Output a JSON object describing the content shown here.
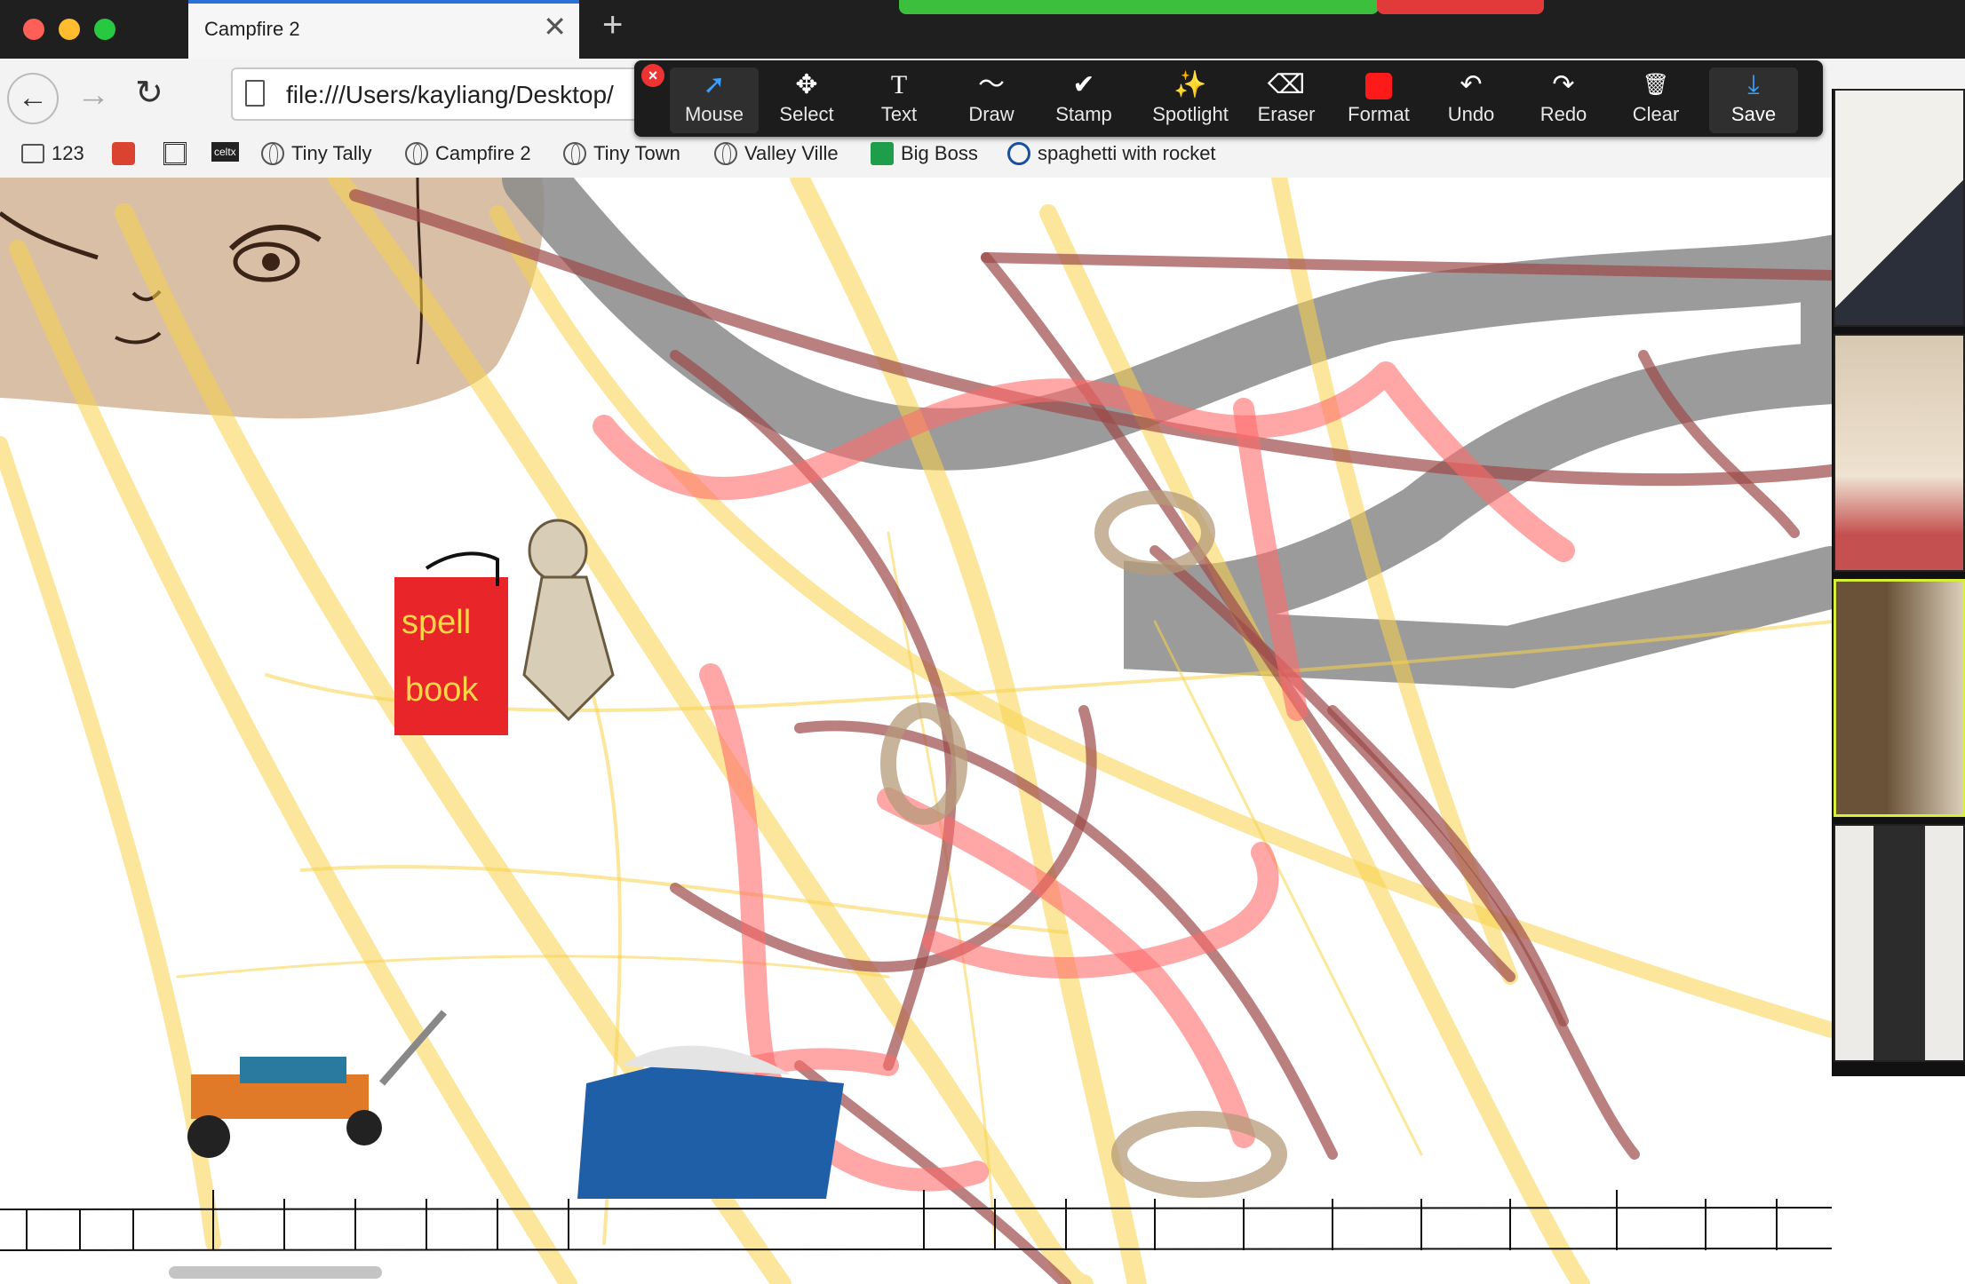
{
  "browser": {
    "tab_title": "Campfire 2",
    "url": "file:///Users/kayliang/Desktop/",
    "new_tab_symbol": "+",
    "tab_close_symbol": "✕"
  },
  "bookmarks": [
    {
      "label": "123",
      "icon": "folder-icon"
    },
    {
      "label": "",
      "icon": "mask-icon"
    },
    {
      "label": "",
      "icon": "frame-icon"
    },
    {
      "label": "",
      "icon": "celtx-icon",
      "text": "celtx"
    },
    {
      "label": "Tiny Tally",
      "icon": "globe-icon"
    },
    {
      "label": "Campfire 2",
      "icon": "globe-icon"
    },
    {
      "label": "Tiny Town",
      "icon": "globe-icon"
    },
    {
      "label": "Valley Ville",
      "icon": "globe-icon"
    },
    {
      "label": "Big Boss",
      "icon": "sheets-icon"
    },
    {
      "label": "spaghetti with rocket",
      "icon": "rocket-icon"
    }
  ],
  "annotation_toolbar": {
    "tools": [
      {
        "id": "mouse",
        "label": "Mouse",
        "icon": "cursor-icon",
        "glyph": "➚",
        "active": true
      },
      {
        "id": "select",
        "label": "Select",
        "icon": "move-icon",
        "glyph": "✥"
      },
      {
        "id": "text",
        "label": "Text",
        "icon": "text-icon",
        "glyph": "T"
      },
      {
        "id": "draw",
        "label": "Draw",
        "icon": "squiggle-icon",
        "glyph": "〜"
      },
      {
        "id": "stamp",
        "label": "Stamp",
        "icon": "check-icon",
        "glyph": "✔"
      },
      {
        "id": "spotlight",
        "label": "Spotlight",
        "icon": "wand-icon",
        "glyph": "✨"
      },
      {
        "id": "eraser",
        "label": "Eraser",
        "icon": "eraser-icon",
        "glyph": "⌫"
      },
      {
        "id": "format",
        "label": "Format",
        "icon": "color-swatch-icon",
        "glyph": ""
      },
      {
        "id": "undo",
        "label": "Undo",
        "icon": "undo-icon",
        "glyph": "↶"
      },
      {
        "id": "redo",
        "label": "Redo",
        "icon": "redo-icon",
        "glyph": "↷"
      },
      {
        "id": "clear",
        "label": "Clear",
        "icon": "trash-icon",
        "glyph": "🗑"
      },
      {
        "id": "save",
        "label": "Save",
        "icon": "download-icon",
        "glyph": "⤓"
      }
    ],
    "format_color": "#ff1a1a"
  },
  "canvas": {
    "spell_book": [
      "spell",
      "book"
    ],
    "colors": {
      "yellow_scribble": "#f7d24a",
      "red_scribble": "#ff6b6b",
      "maroon_scribble": "#9c4a4a",
      "gray_stroke": "#8a8a8a",
      "tan_scribble": "#b69a7a",
      "book_red": "#e8262a"
    }
  }
}
